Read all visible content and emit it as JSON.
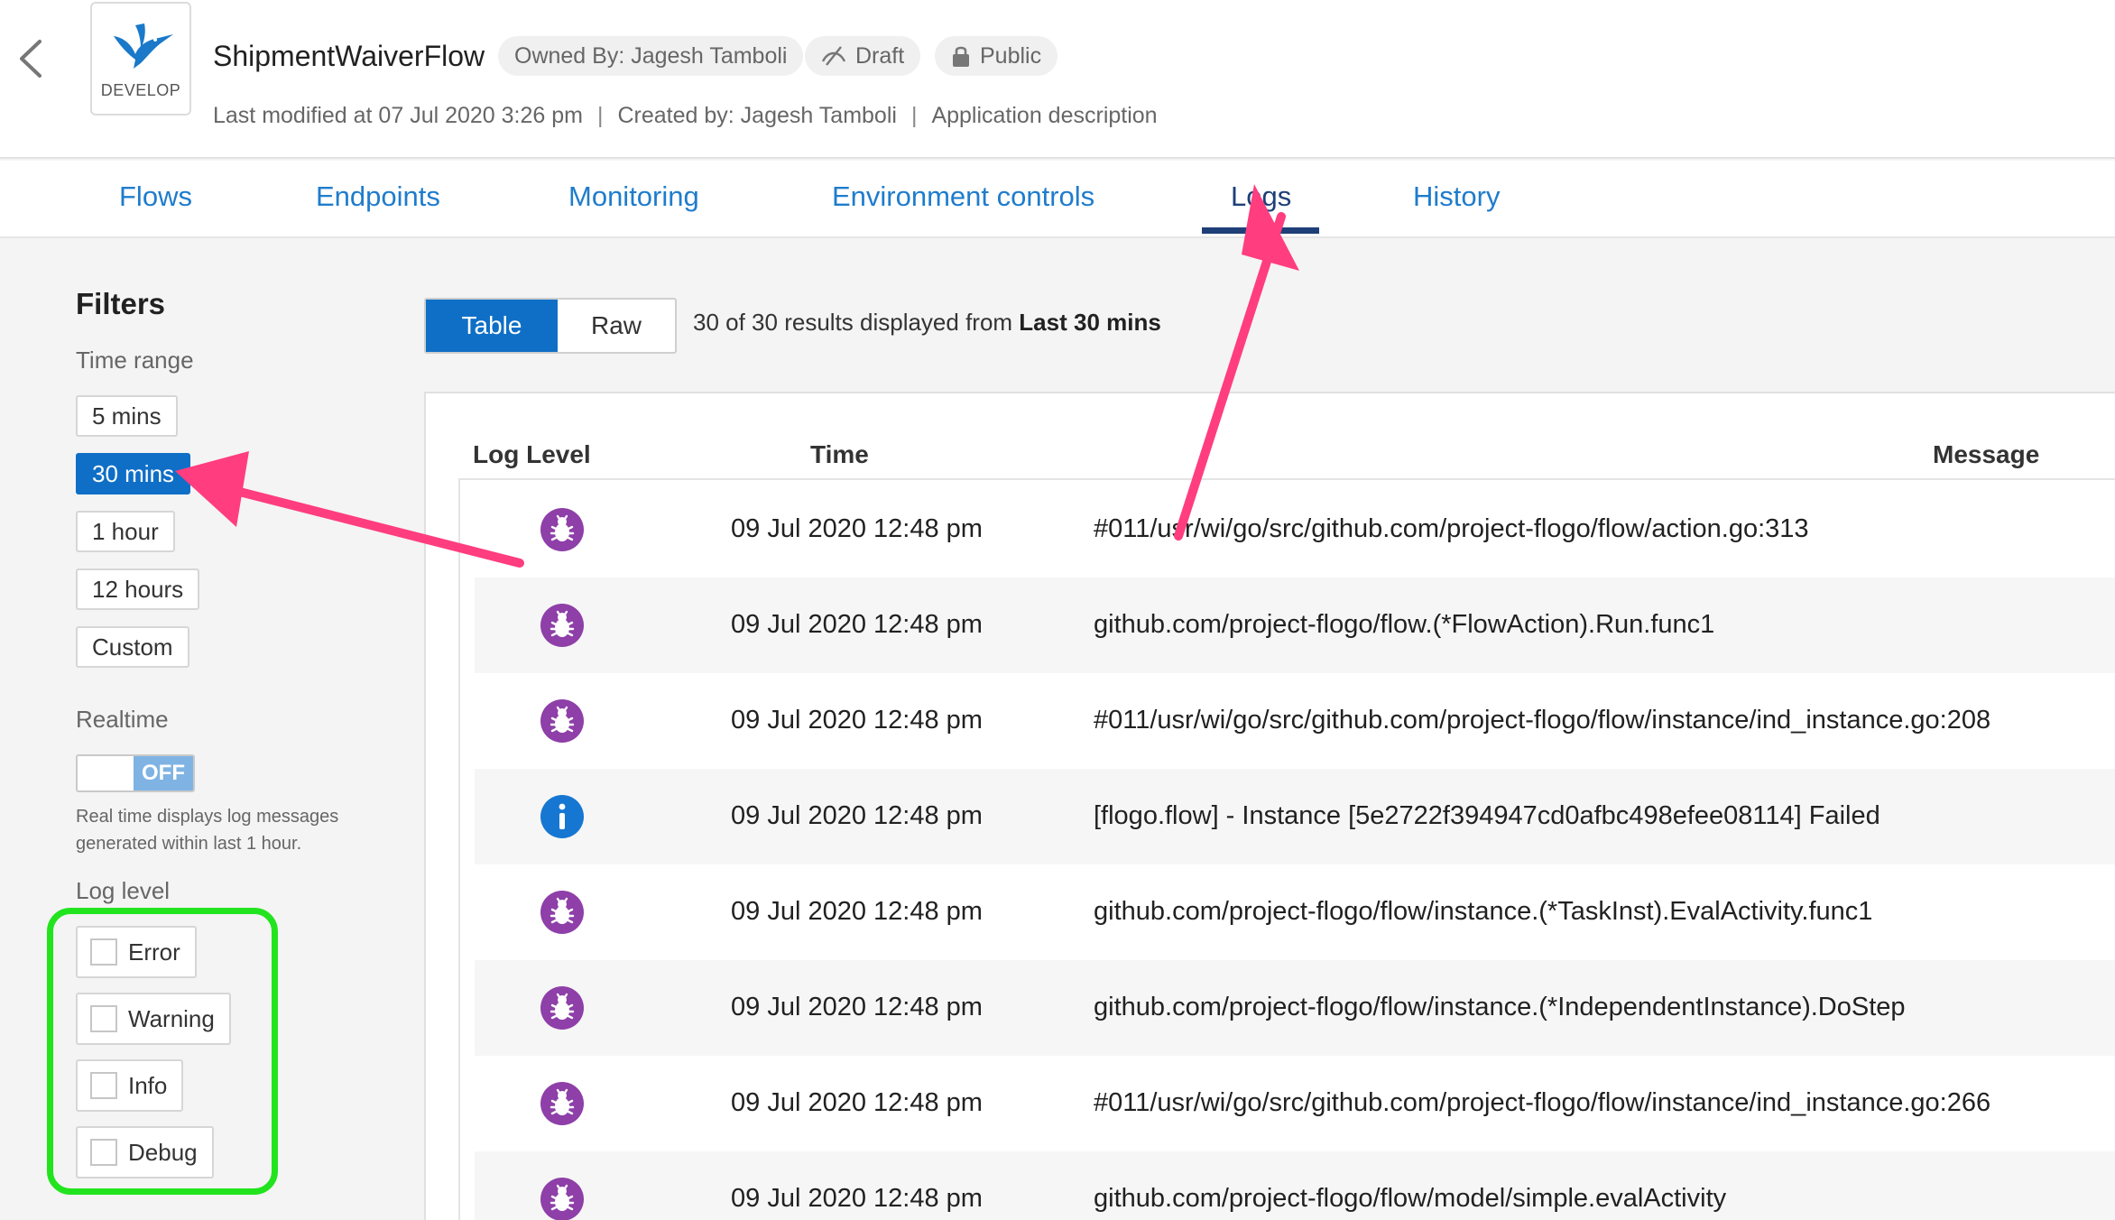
{
  "header": {
    "app_name": "ShipmentWaiverFlow",
    "logo_label": "DEVELOP",
    "owner": "Owned By: Jagesh Tamboli",
    "status": "Draft",
    "visibility": "Public",
    "meta": {
      "modified": "Last modified at 07 Jul 2020 3:26 pm",
      "separator": "|",
      "created": "Created by: Jagesh Tamboli",
      "description": "Application description"
    }
  },
  "tabs": {
    "flows": "Flows",
    "endpoints": "Endpoints",
    "monitoring": "Monitoring",
    "env": "Environment controls",
    "logs": "Logs",
    "history": "History",
    "active": "Logs"
  },
  "filters": {
    "title": "Filters",
    "time_range_label": "Time range",
    "time_ranges": [
      "5 mins",
      "30 mins",
      "1 hour",
      "12 hours",
      "Custom"
    ],
    "selected_time_range": "30 mins",
    "realtime_label": "Realtime",
    "realtime_state": "OFF",
    "realtime_help": "Real time displays log messages generated within last 1 hour.",
    "log_level_label": "Log level",
    "log_levels": [
      "Error",
      "Warning",
      "Info",
      "Debug"
    ]
  },
  "view": {
    "table_label": "Table",
    "raw_label": "Raw",
    "results_prefix": "30 of 30 results displayed from ",
    "results_range": "Last 30 mins"
  },
  "table": {
    "columns": {
      "level": "Log Level",
      "time": "Time",
      "message": "Message"
    },
    "rows": [
      {
        "level": "debug",
        "time": "09 Jul 2020 12:48 pm",
        "message": "#011/usr/wi/go/src/github.com/project-flogo/flow/action.go:313"
      },
      {
        "level": "debug",
        "time": "09 Jul 2020 12:48 pm",
        "message": "github.com/project-flogo/flow.(*FlowAction).Run.func1"
      },
      {
        "level": "debug",
        "time": "09 Jul 2020 12:48 pm",
        "message": "#011/usr/wi/go/src/github.com/project-flogo/flow/instance/ind_instance.go:208"
      },
      {
        "level": "info",
        "time": "09 Jul 2020 12:48 pm",
        "message": "[flogo.flow] - Instance [5e2722f394947cd0afbc498efee08114] Failed"
      },
      {
        "level": "debug",
        "time": "09 Jul 2020 12:48 pm",
        "message": "github.com/project-flogo/flow/instance.(*TaskInst).EvalActivity.func1"
      },
      {
        "level": "debug",
        "time": "09 Jul 2020 12:48 pm",
        "message": "github.com/project-flogo/flow/instance.(*IndependentInstance).DoStep"
      },
      {
        "level": "debug",
        "time": "09 Jul 2020 12:48 pm",
        "message": "#011/usr/wi/go/src/github.com/project-flogo/flow/instance/ind_instance.go:266"
      },
      {
        "level": "debug",
        "time": "09 Jul 2020 12:48 pm",
        "message": "github.com/project-flogo/flow/model/simple.evalActivity"
      }
    ]
  },
  "icons": {
    "debug": "bug-icon",
    "info": "info-icon"
  },
  "colors": {
    "primary": "#0f6fc6",
    "link": "#1f7ccc",
    "active_tab": "#1e3f78",
    "debug_icon": "#8e3fa8",
    "info_icon": "#1677d2",
    "annotation_arrow": "#ff3d7f",
    "annotation_box": "#22e41e"
  }
}
